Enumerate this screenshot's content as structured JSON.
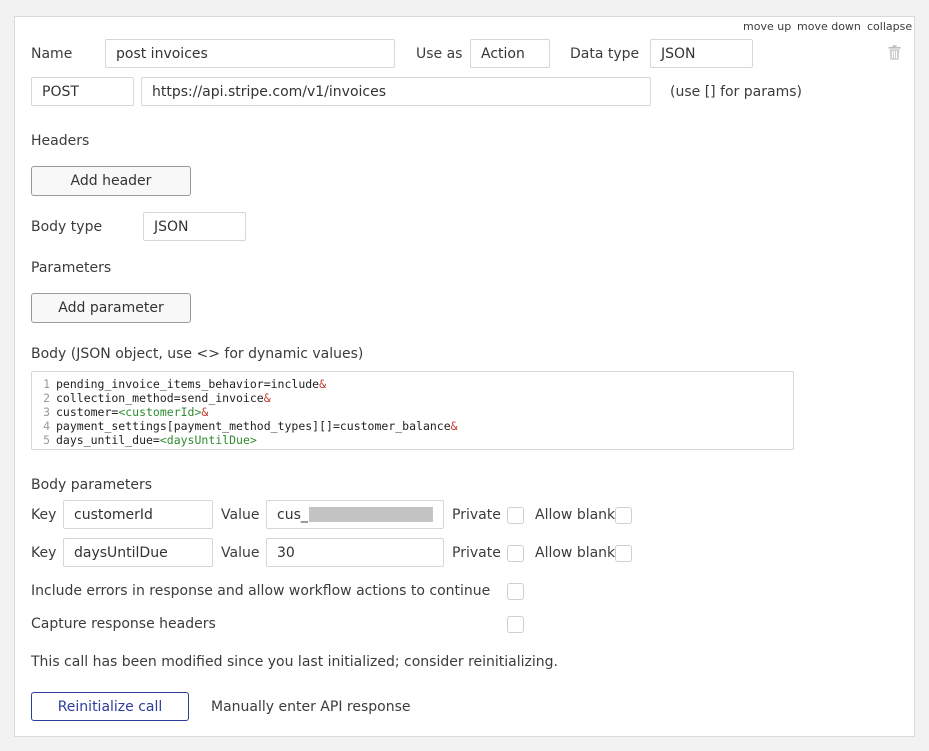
{
  "top_links": {
    "move_up": "move up",
    "move_down": "move down",
    "collapse": "collapse"
  },
  "name_row": {
    "name_label": "Name",
    "name_value": "post invoices",
    "use_as_label": "Use as",
    "use_as_value": "Action",
    "data_type_label": "Data type",
    "data_type_value": "JSON"
  },
  "request": {
    "method": "POST",
    "url": "https://api.stripe.com/v1/invoices",
    "hint": "(use [] for params)"
  },
  "headers": {
    "title": "Headers",
    "add_button": "Add header"
  },
  "body_type": {
    "label": "Body type",
    "value": "JSON"
  },
  "parameters": {
    "title": "Parameters",
    "add_button": "Add parameter"
  },
  "body": {
    "title": "Body (JSON object, use <> for dynamic values)",
    "lines": [
      {
        "num": "1",
        "text": "pending_invoice_items_behavior=include",
        "dynamic": "",
        "suffix": "&"
      },
      {
        "num": "2",
        "text": "collection_method=send_invoice",
        "dynamic": "",
        "suffix": "&"
      },
      {
        "num": "3",
        "text": "customer=",
        "dynamic": "<customerId>",
        "suffix": "&"
      },
      {
        "num": "4",
        "text": "payment_settings[payment_method_types][]=customer_balance",
        "dynamic": "",
        "suffix": "&"
      },
      {
        "num": "5",
        "text": "days_until_due=",
        "dynamic": "<daysUntilDue>",
        "suffix": ""
      }
    ]
  },
  "body_parameters": {
    "title": "Body parameters",
    "key_label": "Key",
    "value_label": "Value",
    "private_label": "Private",
    "allow_blank_label": "Allow blank",
    "rows": [
      {
        "key": "customerId",
        "value": "cus_"
      },
      {
        "key": "daysUntilDue",
        "value": "30"
      }
    ]
  },
  "options": {
    "include_errors": "Include errors in response and allow workflow actions to continue",
    "capture_headers": "Capture response headers"
  },
  "notice": "This call has been modified since you last initialized; consider reinitializing.",
  "actions": {
    "reinitialize": "Reinitialize call",
    "manual": "Manually enter API response"
  },
  "icons": {
    "delete": "trash-icon"
  }
}
